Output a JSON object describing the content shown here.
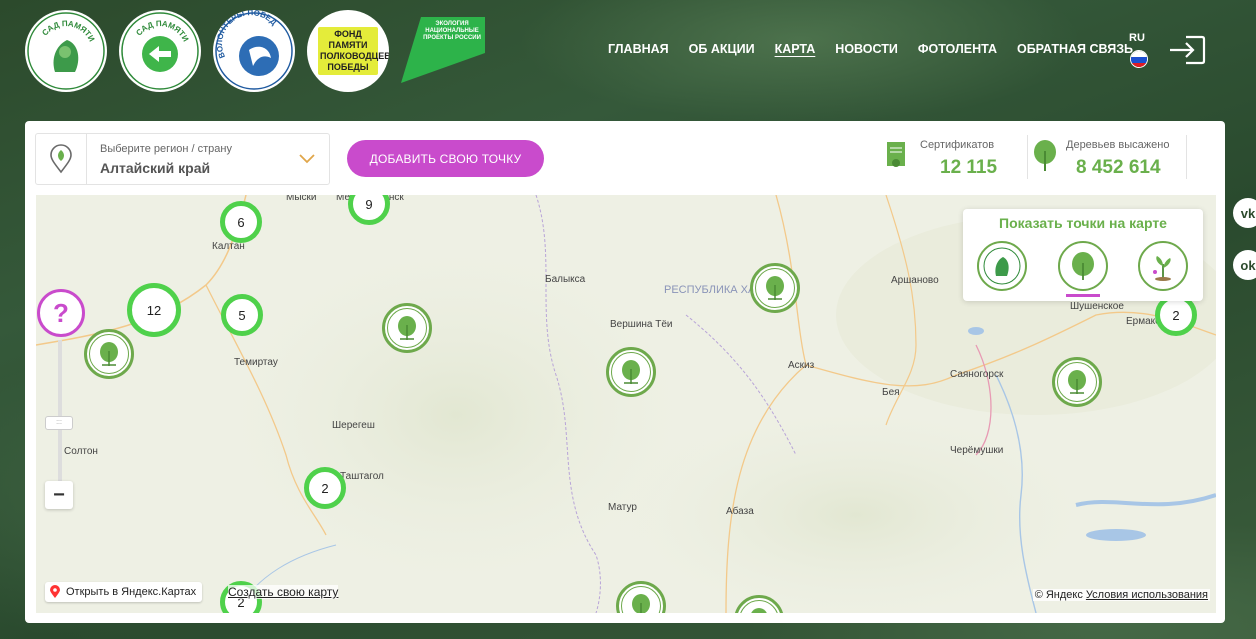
{
  "header": {
    "logos": [
      {
        "name": "sad-pamyati-logo",
        "text": "САД ПАМЯТИ"
      },
      {
        "name": "sad-pamyati-hub-logo",
        "text": "САД ПАМЯТИ"
      },
      {
        "name": "volunteers-logo",
        "text": "ВОЛОНТЁРЫ ПОБЕДЫ"
      },
      {
        "name": "fund-logo",
        "text": "ФОНД ПАМЯТИ ПОЛКОВОДЦЕВ ПОБЕДЫ"
      },
      {
        "name": "national-projects-logo",
        "line1": "ЭКОЛОГИЯ",
        "line2": "НАЦИОНАЛЬНЫЕ ПРОЕКТЫ РОССИИ"
      }
    ],
    "nav": [
      "ГЛАВНАЯ",
      "ОБ АКЦИИ",
      "КАРТА",
      "НОВОСТИ",
      "ФОТОЛЕНТА",
      "ОБРАТНАЯ СВЯЗЬ"
    ],
    "active_nav": "КАРТА",
    "lang": "RU"
  },
  "region": {
    "label": "Выберите регион / страну",
    "value": "Алтайский край"
  },
  "add_button": "ДОБАВИТЬ СВОЮ ТОЧКУ",
  "stats": {
    "certificates_label": "Сертификатов",
    "certificates_value": "12 115",
    "trees_label": "Деревьев высажено",
    "trees_value": "8 452 614"
  },
  "map": {
    "cities": [
      "Мыски",
      "Междуреченск",
      "Калтан",
      "Балыкса",
      "Темиртау",
      "Шерегеш",
      "Солтон",
      "Вершина Тёи",
      "Аскиз",
      "Бея",
      "Аршаново",
      "Шушенское",
      "Ермаковское",
      "Саяногорск",
      "Черёмушки",
      "Матур",
      "Абаза",
      "Таштагол"
    ],
    "region_label": "РЕСПУБЛИКА ХАКАСИЯ",
    "clusters": [
      "9",
      "6",
      "12",
      "5",
      "2",
      "2",
      "2"
    ],
    "help": "?",
    "zoom_out": "−",
    "filter_title": "Показать точки на карте",
    "open_yandex": "Открыть в Яндекс.Картах",
    "create_map": "Создать свою карту",
    "copyright": "© Яндекс",
    "terms": "Условия использования"
  },
  "social": [
    "vk",
    "ok"
  ],
  "colors": {
    "accent_green": "#6ab04c",
    "cluster_green": "#4fd14b",
    "magenta": "#c94bcc"
  }
}
